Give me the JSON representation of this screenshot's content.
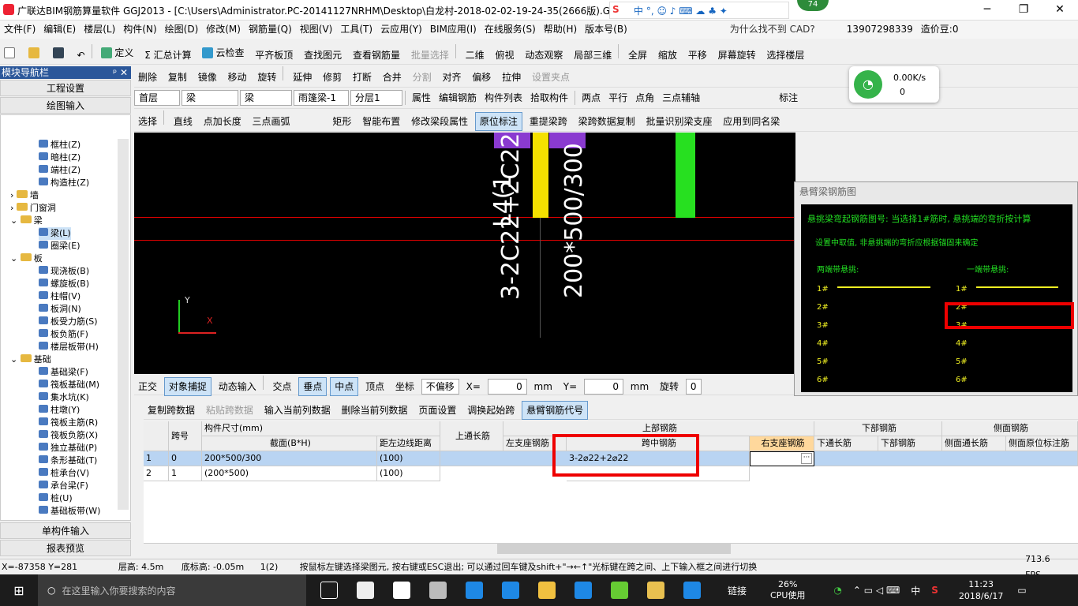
{
  "window": {
    "title": "广联达BIM钢筋算量软件 GGJ2013 - [C:\\Users\\Administrator.PC-20141127NRHM\\Desktop\\白龙村-2018-02-02-19-24-35(2666版).GGJ12]",
    "min": "─",
    "max": "❐",
    "close": "✕"
  },
  "menu": [
    "文件(F)",
    "编辑(E)",
    "楼层(L)",
    "构件(N)",
    "绘图(D)",
    "修改(M)",
    "钢筋量(Q)",
    "视图(V)",
    "工具(T)",
    "云应用(Y)",
    "BIM应用(I)",
    "在线服务(S)",
    "帮助(H)",
    "版本号(B)"
  ],
  "menu_right": {
    "help_text": "为什么找不到 CAD?",
    "phone": "13907298339",
    "beans": "造价豆:0",
    "num": "74"
  },
  "tb1": [
    "定义",
    "Σ 汇总计算",
    "云检查",
    "平齐板顶",
    "查找图元",
    "查看钢筋量",
    "批量选择",
    "二维",
    "俯视",
    "动态观察",
    "局部三维",
    "全屏",
    "缩放",
    "平移",
    "屏幕旋转",
    "选择楼层"
  ],
  "tb2": [
    "删除",
    "复制",
    "镜像",
    "移动",
    "旋转",
    "延伸",
    "修剪",
    "打断",
    "合并",
    "分割",
    "对齐",
    "偏移",
    "拉伸",
    "设置夹点"
  ],
  "tb3": {
    "floor": "首层",
    "type1": "梁",
    "type2": "梁",
    "name": "雨篷梁-1",
    "layer": "分层1",
    "items": [
      "属性",
      "编辑钢筋",
      "构件列表",
      "拾取构件",
      "两点",
      "平行",
      "点角",
      "三点辅轴",
      "标注"
    ]
  },
  "tb4": [
    "选择",
    "直线",
    "点加长度",
    "三点画弧",
    "矩形",
    "智能布置",
    "修改梁段属性",
    "原位标注",
    "重提梁跨",
    "梁跨数据复制",
    "批量识别梁支座",
    "应用到同名梁"
  ],
  "network": {
    "speed": "0.00K/s",
    "count": "0"
  },
  "nav": {
    "title": "模块导航栏",
    "pin": "ᵖ ✕",
    "btn1": "工程设置",
    "btn2": "绘图输入",
    "btn3": "单构件输入",
    "btn4": "报表预览"
  },
  "tree": [
    "框柱(Z)",
    "暗柱(Z)",
    "端柱(Z)",
    "构造柱(Z)",
    "墙",
    "门窗洞",
    "梁",
    "梁(L)",
    "圈梁(E)",
    "板",
    "现浇板(B)",
    "螺旋板(B)",
    "柱帽(V)",
    "板洞(N)",
    "板受力筋(S)",
    "板负筋(F)",
    "楼层板带(H)",
    "基础",
    "基础梁(F)",
    "筏板基础(M)",
    "集水坑(K)",
    "柱墩(Y)",
    "筏板主筋(R)",
    "筏板负筋(X)",
    "独立基础(P)",
    "条形基础(T)",
    "桩承台(V)",
    "承台梁(F)",
    "桩(U)",
    "基础板带(W)"
  ],
  "canvas": {
    "text1": "L4(1",
    "text2": "3-2C22+2C22",
    "text3": "200*500/300",
    "axis_y": "Y",
    "axis_x": "X"
  },
  "cantilever": {
    "title": "悬臂梁钢筋图",
    "heading": "悬挑梁弯起钢筋图号: 当选择1#筋时, 悬挑端的弯折按计算",
    "line2": "设置中取值, 非悬挑端的弯折应根据锚固来确定",
    "both": "两端带悬挑:",
    "one": "一端带悬挑:",
    "nums": [
      "1#",
      "2#",
      "3#",
      "4#",
      "5#",
      "6#"
    ]
  },
  "snapbar": [
    "正交",
    "对象捕捉",
    "动态输入",
    "交点",
    "垂点",
    "中点",
    "顶点",
    "坐标",
    "不偏移",
    "X=",
    "0",
    "mm",
    "Y=",
    "0",
    "mm",
    "旋转",
    "0"
  ],
  "gridtb": [
    "复制跨数据",
    "粘贴跨数据",
    "输入当前列数据",
    "删除当前列数据",
    "页面设置",
    "调换起始跨",
    "悬臂钢筋代号"
  ],
  "table": {
    "h_span": "跨号",
    "h_size": "构件尺寸(mm)",
    "h_sec": "截面(B*H)",
    "h_dist": "距左边线距离",
    "h_top": "上通长筋",
    "h_upper": "上部钢筋",
    "h_left": "左支座钢筋",
    "h_mid": "跨中钢筋",
    "h_right": "右支座钢筋",
    "h_lower": "下部钢筋",
    "h_bot": "下通长筋",
    "h_botbar": "下部钢筋",
    "h_side": "侧面钢筋",
    "h_sidel": "侧面通长筋",
    "h_sideo": "侧面原位标注筋",
    "rows": [
      {
        "n": "1",
        "span": "0",
        "sec": "200*500/300",
        "dist": "(100)",
        "mid": "3-2⌀22+2⌀22"
      },
      {
        "n": "2",
        "span": "1",
        "sec": "(200*500)",
        "dist": "(100)",
        "mid": ""
      }
    ]
  },
  "status": {
    "coord": "X=-87358 Y=281",
    "height": "层高: 4.5m",
    "base": "底标高: -0.05m",
    "count": "1(2)",
    "hint": "按鼠标左键选择梁图元, 按右键或ESC退出; 可以通过回车键及shift+\"→←↑\"光标键在跨之间、上下输入框之间进行切换",
    "fps": "713.6 FPS"
  },
  "taskbar": {
    "search": "在这里输入你要搜索的内容",
    "link": "链接",
    "cpu": "26%",
    "cpu_label": "CPU使用",
    "lang": "中",
    "time": "11:23",
    "date": "2018/6/17"
  }
}
